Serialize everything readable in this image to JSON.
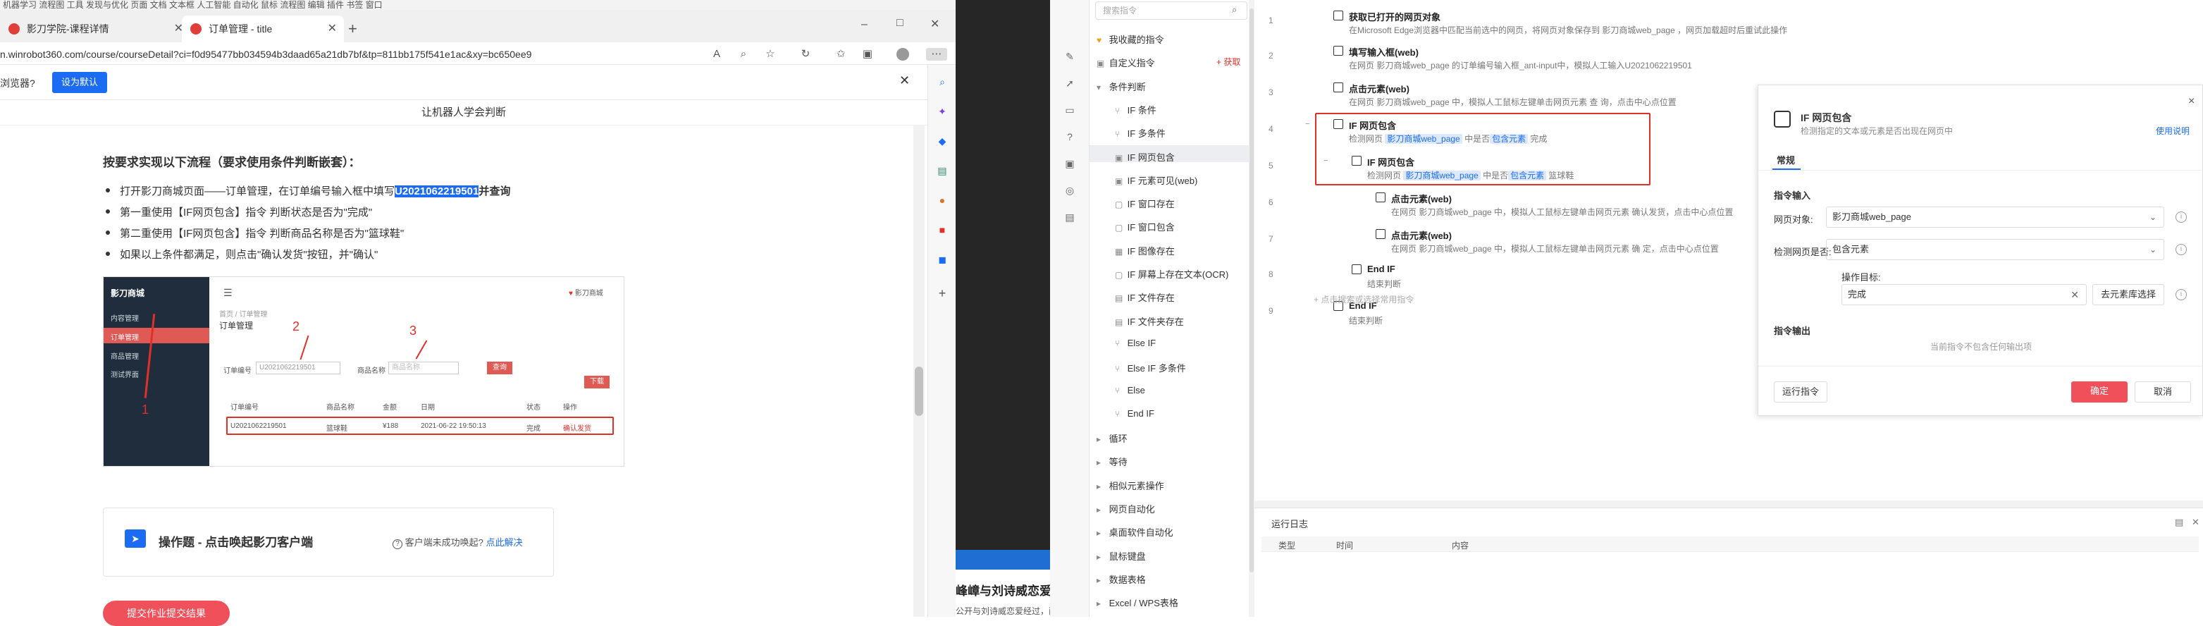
{
  "top_strip": {
    "text": "机器学习  流程图  工具  发现与优化  页面  文档  文本框  人工智能  自动化  鼠标  流程图  编辑  插件  书签  窗口"
  },
  "browser": {
    "tabs": [
      {
        "title": "影刀学院-课程详情",
        "active": false
      },
      {
        "title": "订单管理 - title",
        "active": true
      }
    ],
    "new_tab": "+",
    "window_controls": {
      "minimize": "–",
      "maximize": "□",
      "close": "✕"
    },
    "url": "n.winrobot360.com/course/courseDetail?ci=f0d95477bb034594b3daad65a21db7bf&tp=811bb175f541e1ac&xy=bc650ee9",
    "infobar": {
      "question": "浏览器?",
      "button": "设为默认",
      "close": "✕"
    },
    "page_heading": "让机器人学会判断",
    "task_heading": "按要求实现以下流程（要求使用条件判断嵌套）：",
    "bullets": [
      {
        "pre": "打开影刀商城页面——订单管理，在订单编号输入框中填写",
        "hl": "U2021062219501",
        "post": "并查询"
      },
      {
        "pre": "第一重使用【IF网页包含】指令 判断状态是否为\"完成\"",
        "hl": "",
        "post": ""
      },
      {
        "pre": "第二重使用【IF网页包含】指令 判断商品名称是否为\"篮球鞋\"",
        "hl": "",
        "post": ""
      },
      {
        "pre": "如果以上条件都满足，则点击\"确认发货\"按钮，并\"确认\"",
        "hl": "",
        "post": ""
      }
    ],
    "shot": {
      "brand": "影刀商城",
      "menu": [
        "内容管理",
        "订单管理",
        "商品管理",
        "测试界面"
      ],
      "crumb": "首页 / 订单管理",
      "title": "订单管理",
      "user": "影刀商城",
      "label_order": "订单编号",
      "order_value": "U2021062219501",
      "label_goods": "商品名称",
      "goods_ph": "商品名称",
      "query_btn": "查询",
      "add_btn": "下载",
      "cols": [
        "订单编号",
        "商品名称",
        "金额",
        "日期",
        "状态",
        "操作"
      ],
      "row": [
        "U2021062219501",
        "篮球鞋",
        "¥188",
        "2021-06-22 19:50:13",
        "完成",
        "确认发货"
      ],
      "marks": [
        "1",
        "2",
        "3"
      ]
    },
    "opcard": {
      "title": "操作题 - 点击唤起影刀客户端",
      "hint": "客户端未成功唤起?",
      "link": "点此解决"
    },
    "submit": "提交作业提交结果"
  },
  "mid": {
    "headline": "峰嶂与刘诗威恋爱经过",
    "sub": "公开与刘诗威恋爱经过，两人"
  },
  "commands": {
    "search_placeholder": "搜索指令",
    "items": [
      {
        "label": "我收藏的指令",
        "indent": 0,
        "glyph": "♥"
      },
      {
        "label": "自定义指令",
        "indent": 0,
        "glyph": "▣",
        "extra": "+ 获取"
      },
      {
        "label": "条件判断",
        "indent": 0,
        "glyph": "▾"
      },
      {
        "label": "IF 条件",
        "indent": 1,
        "glyph": "⑂"
      },
      {
        "label": "IF 多条件",
        "indent": 1,
        "glyph": "⑂"
      },
      {
        "label": "IF 网页包含",
        "indent": 1,
        "glyph": "▣"
      },
      {
        "label": "IF 元素可见(web)",
        "indent": 1,
        "glyph": "▣"
      },
      {
        "label": "IF 窗口存在",
        "indent": 1,
        "glyph": "▢"
      },
      {
        "label": "IF 窗口包含",
        "indent": 1,
        "glyph": "▢"
      },
      {
        "label": "IF 图像存在",
        "indent": 1,
        "glyph": "▦"
      },
      {
        "label": "IF 屏幕上存在文本(OCR)",
        "indent": 1,
        "glyph": "▢"
      },
      {
        "label": "IF 文件存在",
        "indent": 1,
        "glyph": "▤"
      },
      {
        "label": "IF 文件夹存在",
        "indent": 1,
        "glyph": "▤"
      },
      {
        "label": "Else IF",
        "indent": 1,
        "glyph": "⑂"
      },
      {
        "label": "Else IF 多条件",
        "indent": 1,
        "glyph": "⑂"
      },
      {
        "label": "Else",
        "indent": 1,
        "glyph": "⑂"
      },
      {
        "label": "End IF",
        "indent": 1,
        "glyph": "⑂"
      },
      {
        "label": "循环",
        "indent": 0,
        "glyph": "▸"
      },
      {
        "label": "等待",
        "indent": 0,
        "glyph": "▸"
      },
      {
        "label": "相似元素操作",
        "indent": 0,
        "glyph": "▸"
      },
      {
        "label": "网页自动化",
        "indent": 0,
        "glyph": "▸"
      },
      {
        "label": "桌面软件自动化",
        "indent": 0,
        "glyph": "▸"
      },
      {
        "label": "鼠标键盘",
        "indent": 0,
        "glyph": "▸"
      },
      {
        "label": "数据表格",
        "indent": 0,
        "glyph": "▸"
      },
      {
        "label": "Excel / WPS表格",
        "indent": 0,
        "glyph": "▸"
      }
    ]
  },
  "flow": {
    "steps": [
      {
        "n": "1",
        "title": "获取已打开的网页对象",
        "desc": "在Microsoft Edge浏览器中匹配当前选中的网页，将网页对象保存到 影刀商城web_page ，网页加载超时后重试此操作"
      },
      {
        "n": "2",
        "title": "填写输入框(web)",
        "desc": "在网页 影刀商城web_page 的订单编号输入框_ant-input中，模拟人工输入U2021062219501"
      },
      {
        "n": "3",
        "title": "点击元素(web)",
        "desc": "在网页 影刀商城web_page 中，模拟人工鼠标左键单击网页元素 查 询，点击中心点位置"
      },
      {
        "n": "4",
        "title": "IF 网页包含",
        "desc_pre": "检测网页 ",
        "pill1": "影刀商城web_page",
        "desc_mid": " 中是否",
        "pill2": "包含元素",
        "desc_end": " 完成"
      },
      {
        "n": "5",
        "title": "IF 网页包含",
        "desc_pre": "检测网页 ",
        "pill1": "影刀商城web_page",
        "desc_mid": " 中是否",
        "pill2": "包含元素",
        "desc_end": " 篮球鞋"
      },
      {
        "n": "6",
        "title": "点击元素(web)",
        "desc": "在网页 影刀商城web_page 中，模拟人工鼠标左键单击网页元素 确认发货，点击中心点位置"
      },
      {
        "n": "7",
        "title": "点击元素(web)",
        "desc": "在网页 影刀商城web_page 中，模拟人工鼠标左键单击网页元素 确 定，点击中心点位置"
      },
      {
        "n": "8",
        "title": "End IF",
        "desc": "结束判断"
      },
      {
        "n": "9",
        "title": "End IF",
        "desc": "结束判断"
      }
    ],
    "add_hint": "+ 点击搜索或选择常用指令"
  },
  "log": {
    "title": "运行日志",
    "cols": [
      "类型",
      "时间",
      "内容"
    ]
  },
  "props": {
    "title": "IF 网页包含",
    "subtitle": "检测指定的文本或元素是否出现在网页中",
    "help": "使用说明",
    "tab": "常规",
    "input_section": "指令输入",
    "field1_label": "网页对象:",
    "field1_value": "影刀商城web_page",
    "field2_label": "检测网页是否:",
    "field2_value": "包含元素",
    "field3_label": "操作目标:",
    "field3_value": "完成",
    "pick_btn": "去元素库选择",
    "output_section": "指令输出",
    "output_empty": "当前指令不包含任何输出项",
    "run_btn": "运行指令",
    "ok_btn": "确定",
    "cancel_btn": "取消",
    "close": "×"
  }
}
